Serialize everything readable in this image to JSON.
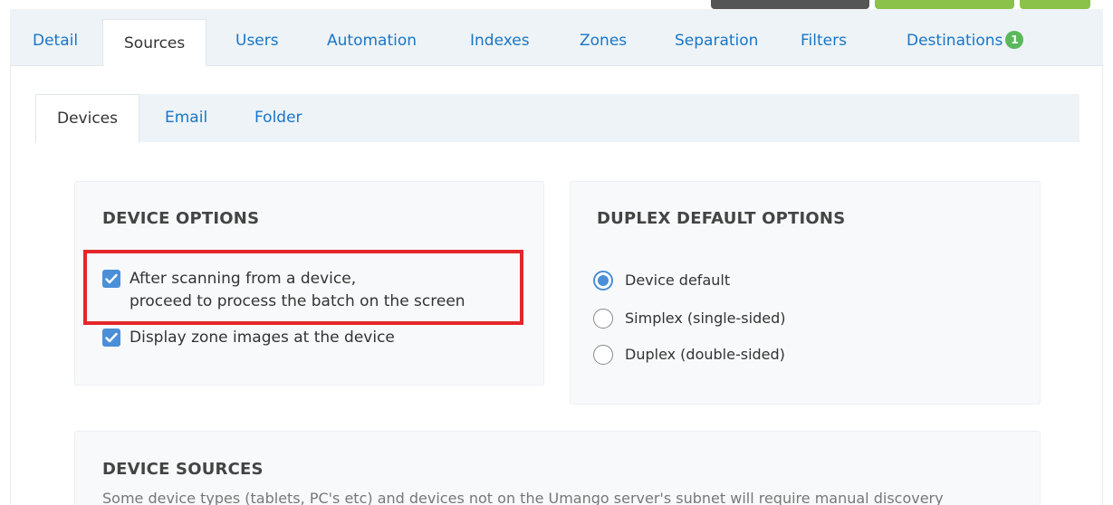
{
  "tabs": [
    {
      "label": "Detail"
    },
    {
      "label": "Sources"
    },
    {
      "label": "Users"
    },
    {
      "label": "Automation"
    },
    {
      "label": "Indexes"
    },
    {
      "label": "Zones"
    },
    {
      "label": "Separation"
    },
    {
      "label": "Filters"
    },
    {
      "label": "Destinations",
      "badge": "1"
    }
  ],
  "subtabs": [
    {
      "label": "Devices"
    },
    {
      "label": "Email"
    },
    {
      "label": "Folder"
    }
  ],
  "device_options": {
    "title": "DEVICE OPTIONS",
    "opt1_line1": "After scanning from a device,",
    "opt1_line2": "proceed to process the batch on the screen",
    "opt2": "Display zone images at the device",
    "opt1_checked": true,
    "opt2_checked": true
  },
  "duplex": {
    "title": "DUPLEX DEFAULT OPTIONS",
    "options": [
      {
        "label": "Device default",
        "selected": true
      },
      {
        "label": "Simplex (single-sided)",
        "selected": false
      },
      {
        "label": "Duplex (double-sided)",
        "selected": false
      }
    ]
  },
  "device_sources": {
    "title": "DEVICE SOURCES",
    "description": "Some device types (tablets, PC's etc) and devices not on the Umango server's subnet will require manual discovery"
  },
  "colors": {
    "accent": "#1976c7",
    "checkbox": "#4a8fd8",
    "badge": "#5cb85c",
    "highlight": "#e3262b"
  }
}
